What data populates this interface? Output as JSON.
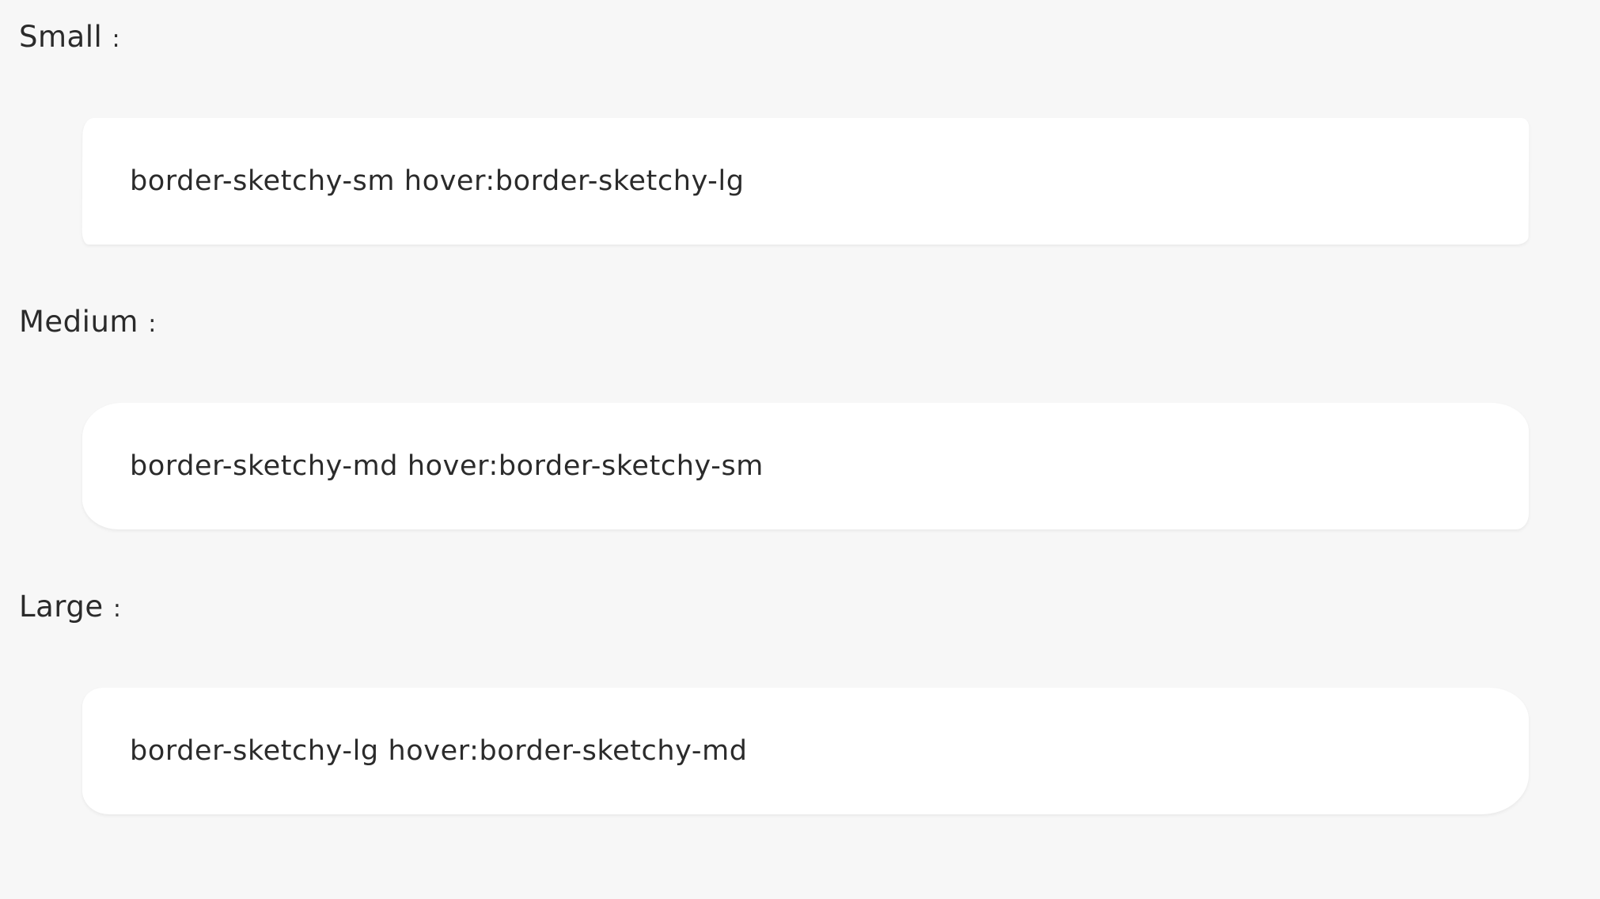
{
  "sections": [
    {
      "label": "Small",
      "colon": ":",
      "card_text": "border-sketchy-sm hover:border-sketchy-lg"
    },
    {
      "label": "Medium",
      "colon": ":",
      "card_text": "border-sketchy-md hover:border-sketchy-sm"
    },
    {
      "label": "Large",
      "colon": ":",
      "card_text": "border-sketchy-lg hover:border-sketchy-md"
    }
  ],
  "colors": {
    "background": "#f7f7f7",
    "card": "#ffffff",
    "text": "#2b2b2b"
  }
}
